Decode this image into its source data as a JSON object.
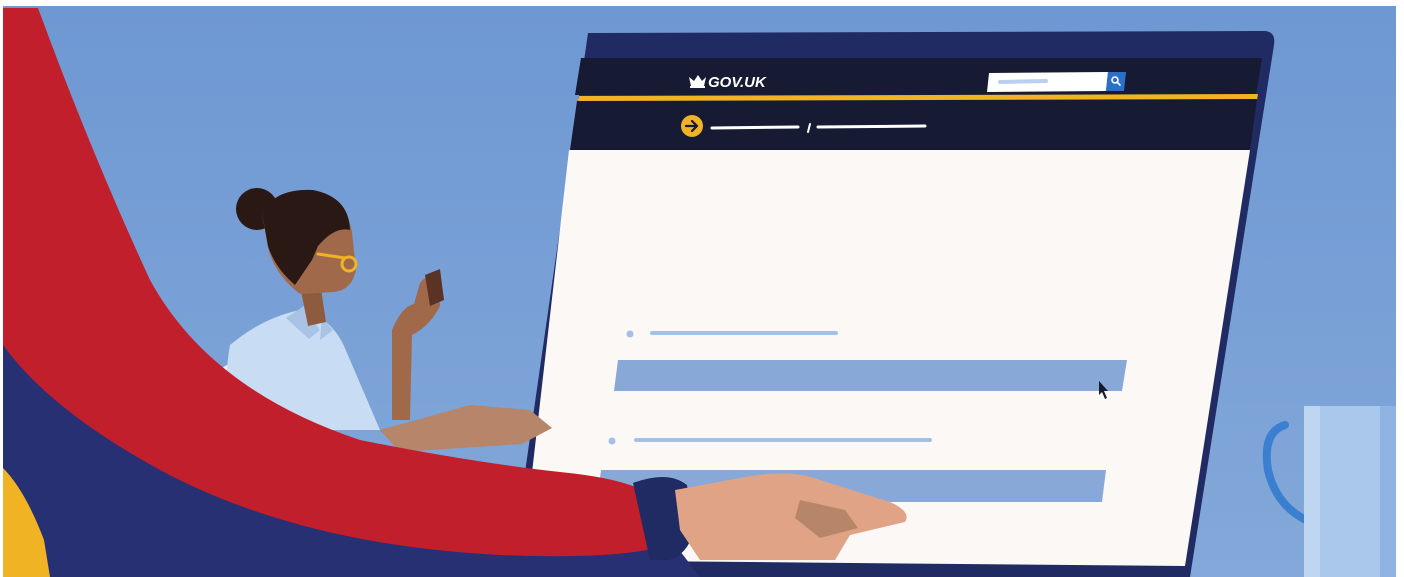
{
  "header": {
    "logo_text": "GOV.UK"
  },
  "colors": {
    "sky": "#7ba1d6",
    "screen_frame": "#202a63",
    "header_bar": "#161a33",
    "accent_yellow": "#f0b324",
    "search_button": "#2b6fc8",
    "form_bar": "#88a9d8",
    "screen_bg": "#fbf8f5",
    "sleeve_red": "#c01f2b",
    "sleeve_navy": "#263072",
    "mug": "#a9c8ec"
  },
  "icons": {
    "logo": "crown-icon",
    "search": "magnifier-icon",
    "breadcrumb": "arrow-right-circle-icon",
    "pointer": "mouse-cursor-icon"
  }
}
